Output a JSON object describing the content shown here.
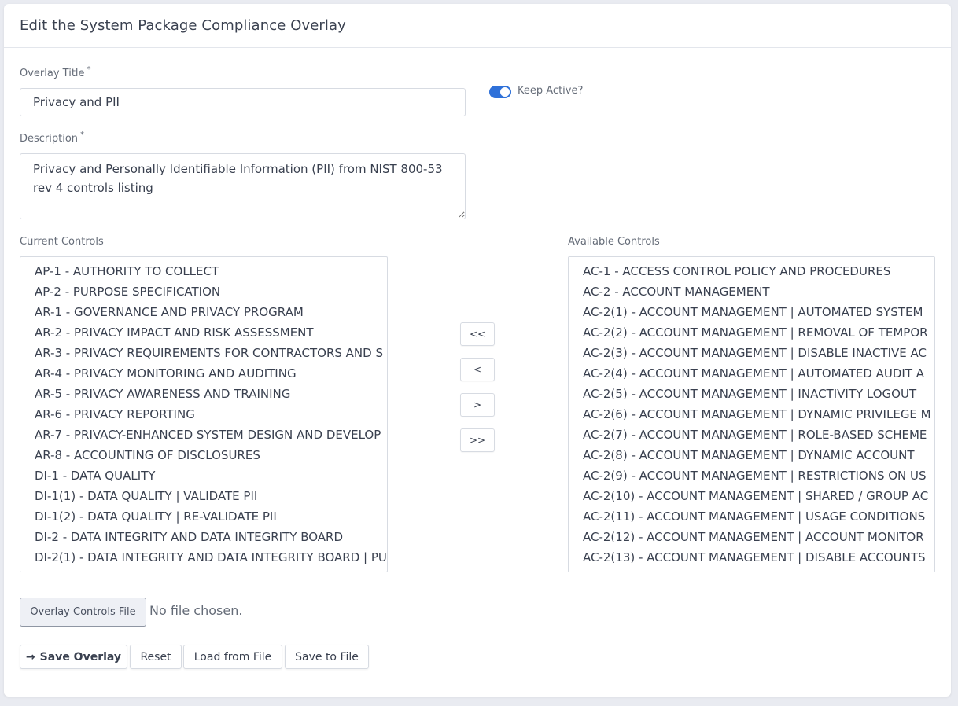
{
  "page": {
    "title": "Edit the System Package Compliance Overlay"
  },
  "form": {
    "overlay_title": {
      "label": "Overlay Title",
      "required_mark": "*",
      "value": "Privacy and PII"
    },
    "keep_active": {
      "label": "Keep Active?",
      "checked": true
    },
    "description": {
      "label": "Description",
      "required_mark": "*",
      "value": "Privacy and Personally Identifiable Information (PII) from NIST 800-53 rev 4 controls listing"
    }
  },
  "current_controls": {
    "label": "Current Controls",
    "items": [
      "AP-1 - AUTHORITY TO COLLECT",
      "AP-2 - PURPOSE SPECIFICATION",
      "AR-1 - GOVERNANCE AND PRIVACY PROGRAM",
      "AR-2 - PRIVACY IMPACT AND RISK ASSESSMENT",
      "AR-3 - PRIVACY REQUIREMENTS FOR CONTRACTORS AND S",
      "AR-4 - PRIVACY MONITORING AND AUDITING",
      "AR-5 - PRIVACY AWARENESS AND TRAINING",
      "AR-6 - PRIVACY REPORTING",
      "AR-7 - PRIVACY-ENHANCED SYSTEM DESIGN AND DEVELOP",
      "AR-8 - ACCOUNTING OF DISCLOSURES",
      "DI-1 - DATA QUALITY",
      "DI-1(1) - DATA QUALITY | VALIDATE PII",
      "DI-1(2) - DATA QUALITY | RE-VALIDATE PII",
      "DI-2 - DATA INTEGRITY AND DATA INTEGRITY BOARD",
      "DI-2(1) - DATA INTEGRITY AND DATA INTEGRITY BOARD | PU"
    ]
  },
  "available_controls": {
    "label": "Available Controls",
    "items": [
      "AC-1 - ACCESS CONTROL POLICY AND PROCEDURES",
      "AC-2 - ACCOUNT MANAGEMENT",
      "AC-2(1) - ACCOUNT MANAGEMENT | AUTOMATED SYSTEM",
      "AC-2(2) - ACCOUNT MANAGEMENT | REMOVAL OF TEMPOR",
      "AC-2(3) - ACCOUNT MANAGEMENT | DISABLE INACTIVE AC",
      "AC-2(4) - ACCOUNT MANAGEMENT | AUTOMATED AUDIT A",
      "AC-2(5) - ACCOUNT MANAGEMENT | INACTIVITY LOGOUT",
      "AC-2(6) - ACCOUNT MANAGEMENT | DYNAMIC PRIVILEGE M",
      "AC-2(7) - ACCOUNT MANAGEMENT | ROLE-BASED SCHEME",
      "AC-2(8) - ACCOUNT MANAGEMENT | DYNAMIC ACCOUNT",
      "AC-2(9) - ACCOUNT MANAGEMENT | RESTRICTIONS ON US",
      "AC-2(10) - ACCOUNT MANAGEMENT | SHARED / GROUP AC",
      "AC-2(11) - ACCOUNT MANAGEMENT | USAGE CONDITIONS",
      "AC-2(12) - ACCOUNT MANAGEMENT | ACCOUNT MONITOR",
      "AC-2(13) - ACCOUNT MANAGEMENT | DISABLE ACCOUNTS"
    ]
  },
  "move_buttons": {
    "move_all_left": "<<",
    "move_left": "<",
    "move_right": ">",
    "move_all_right": ">>"
  },
  "file_input": {
    "button_label": "Overlay Controls File",
    "status": "No file chosen."
  },
  "actions": {
    "save_icon": "arrow-right-icon",
    "save": "Save Overlay",
    "reset": "Reset",
    "load": "Load from File",
    "save_file": "Save to File"
  },
  "colors": {
    "accent": "#2f71d9",
    "page_background": "#e9ebf1"
  }
}
